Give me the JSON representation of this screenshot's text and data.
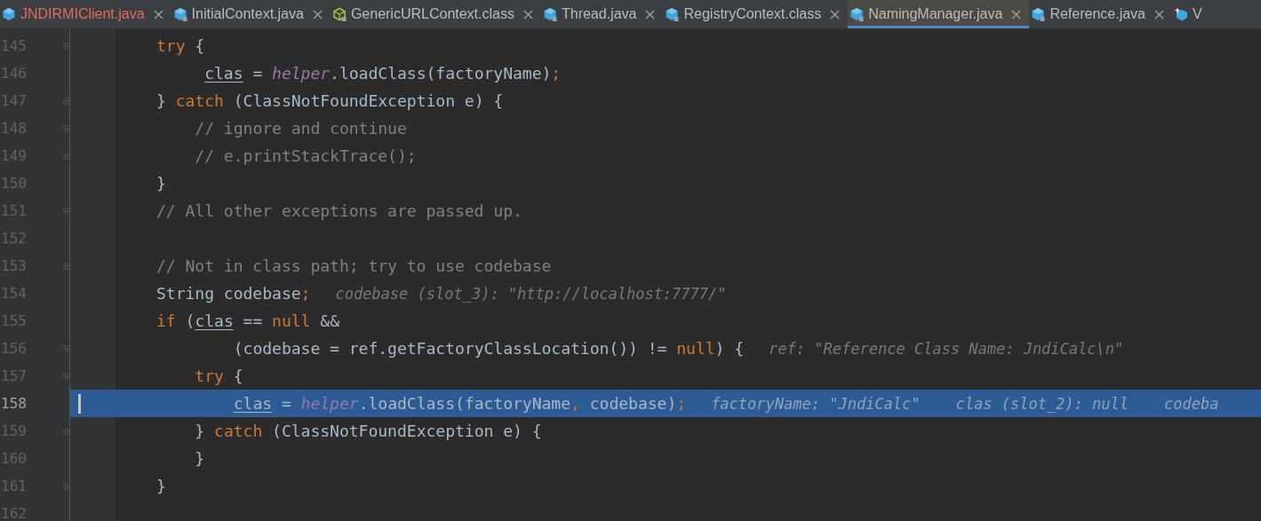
{
  "tabs": [
    {
      "label": "JNDIRMIClient.java",
      "kind": "java-source",
      "error": true,
      "selected": false,
      "close": true
    },
    {
      "label": "InitialContext.java",
      "kind": "java-readonly",
      "error": false,
      "selected": false,
      "close": true
    },
    {
      "label": "GenericURLContext.class",
      "kind": "class-readonly",
      "error": false,
      "selected": false,
      "close": true
    },
    {
      "label": "Thread.java",
      "kind": "java-readonly",
      "error": false,
      "selected": false,
      "close": true
    },
    {
      "label": "RegistryContext.class",
      "kind": "java-readonly",
      "error": false,
      "selected": false,
      "close": true
    },
    {
      "label": "NamingManager.java",
      "kind": "java-readonly",
      "error": false,
      "selected": true,
      "close": true
    },
    {
      "label": "Reference.java",
      "kind": "java-readonly",
      "error": false,
      "selected": false,
      "close": true
    },
    {
      "label": "V",
      "kind": "java-star",
      "error": false,
      "selected": false,
      "close": false
    }
  ],
  "lines": [
    {
      "number": "145",
      "selected": false,
      "fold": {
        "kind": "start"
      },
      "code": [
        {
          "kind": "keyword",
          "text": "try"
        },
        {
          "kind": "plain",
          "text": " {"
        }
      ]
    },
    {
      "number": "146",
      "selected": false,
      "code": [
        {
          "kind": "reassigned",
          "text": "     clas"
        },
        {
          "kind": "plain",
          "text": " = "
        },
        {
          "kind": "field",
          "text": "helper"
        },
        {
          "kind": "plain",
          "text": ".loadClass(factoryName)"
        },
        {
          "kind": "keyword",
          "text": ";"
        }
      ]
    },
    {
      "number": "147",
      "selected": false,
      "fold": {
        "kind": "end"
      },
      "code": [
        {
          "kind": "plain",
          "text": "} "
        },
        {
          "kind": "keyword",
          "text": "catch"
        },
        {
          "kind": "plain",
          "text": " (ClassNotFoundException e) {"
        }
      ]
    },
    {
      "number": "148",
      "selected": false,
      "fold": {
        "kind": "start"
      },
      "code": [
        {
          "kind": "comment",
          "text": "    // ignore and continue"
        }
      ]
    },
    {
      "number": "149",
      "selected": false,
      "fold": {
        "kind": "end"
      },
      "code": [
        {
          "kind": "comment",
          "text": "    // e.printStackTrace();"
        }
      ]
    },
    {
      "number": "150",
      "selected": false,
      "code": [
        {
          "kind": "plain",
          "text": "}"
        }
      ]
    },
    {
      "number": "151",
      "selected": false,
      "fold": {
        "kind": "start"
      },
      "code": [
        {
          "kind": "comment",
          "text": "// All other exceptions are passed up."
        }
      ]
    },
    {
      "number": "152",
      "selected": false
    },
    {
      "number": "153",
      "selected": false,
      "fold": {
        "kind": "end"
      },
      "code": [
        {
          "kind": "comment",
          "text": "// Not in class path; try to use codebase"
        }
      ]
    },
    {
      "number": "154",
      "selected": false,
      "code": [
        {
          "kind": "plain",
          "text": "String codebase"
        },
        {
          "kind": "keyword",
          "text": ";"
        }
      ],
      "hints": [
        "codebase (slot_3): \"http://localhost:7777/\""
      ]
    },
    {
      "number": "155",
      "selected": false,
      "code": [
        {
          "kind": "keyword",
          "text": "if"
        },
        {
          "kind": "plain",
          "text": " ("
        },
        {
          "kind": "reassigned",
          "text": "clas"
        },
        {
          "kind": "plain",
          "text": " == "
        },
        {
          "kind": "keyword",
          "text": "null"
        },
        {
          "kind": "plain",
          "text": " &&"
        }
      ]
    },
    {
      "number": "156",
      "selected": false,
      "fold": {
        "kind": "start"
      },
      "code": [
        {
          "kind": "plain",
          "text": "        (codebase = ref.getFactoryClassLocation()) != "
        },
        {
          "kind": "keyword",
          "text": "null"
        },
        {
          "kind": "plain",
          "text": ") {"
        }
      ],
      "hints": [
        "ref: \"Reference Class Name: JndiCalc\\n\""
      ]
    },
    {
      "number": "157",
      "selected": false,
      "fold": {
        "kind": "start"
      },
      "code": [
        {
          "kind": "keyword",
          "text": "    try"
        },
        {
          "kind": "plain",
          "text": " {"
        }
      ]
    },
    {
      "number": "158",
      "selected": true,
      "code": [
        {
          "kind": "reassigned",
          "text": "        clas"
        },
        {
          "kind": "plain",
          "text": " = "
        },
        {
          "kind": "field",
          "text": "helper"
        },
        {
          "kind": "plain",
          "text": ".loadClass(factoryName"
        },
        {
          "kind": "keyword",
          "text": ","
        },
        {
          "kind": "plain",
          "text": " codebase)"
        },
        {
          "kind": "keyword",
          "text": ";"
        }
      ],
      "hints": [
        "factoryName: \"JndiCalc\"",
        "clas (slot_2): null",
        "codeba"
      ]
    },
    {
      "number": "159",
      "selected": false,
      "fold": {
        "kind": "end"
      },
      "code": [
        {
          "kind": "plain",
          "text": "    } "
        },
        {
          "kind": "keyword",
          "text": "catch"
        },
        {
          "kind": "plain",
          "text": " (ClassNotFoundException e) {"
        }
      ]
    },
    {
      "number": "160",
      "selected": false,
      "code": [
        {
          "kind": "plain",
          "text": "    }"
        }
      ]
    },
    {
      "number": "161",
      "selected": false,
      "fold": {
        "kind": "end"
      },
      "code": [
        {
          "kind": "plain",
          "text": "}"
        }
      ]
    },
    {
      "number": "162",
      "selected": false
    }
  ]
}
